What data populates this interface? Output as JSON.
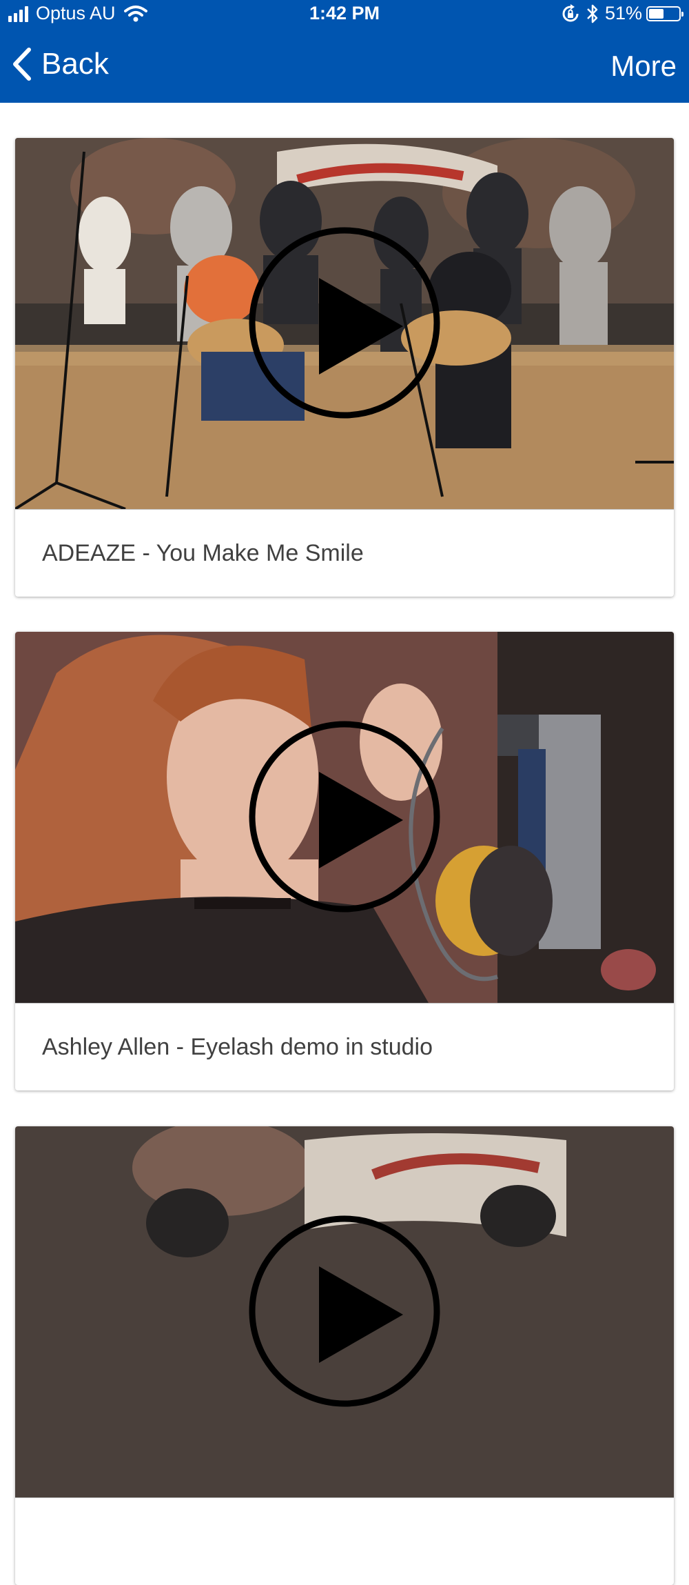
{
  "status_bar": {
    "carrier": "Optus AU",
    "time": "1:42 PM",
    "battery": "51%",
    "battery_level": 0.51
  },
  "nav": {
    "back_label": "Back",
    "more_label": "More"
  },
  "videos": [
    {
      "title": "ADEAZE - You Make Me Smile"
    },
    {
      "title": "Ashley Allen - Eyelash demo in studio"
    },
    {
      "title": ""
    }
  ],
  "colors": {
    "header": "#0055b0",
    "caption_text": "#404040"
  },
  "icons": [
    "cellular-signal-icon",
    "wifi-icon",
    "rotation-lock-icon",
    "bluetooth-icon",
    "battery-icon",
    "chevron-left-icon",
    "play-icon"
  ]
}
